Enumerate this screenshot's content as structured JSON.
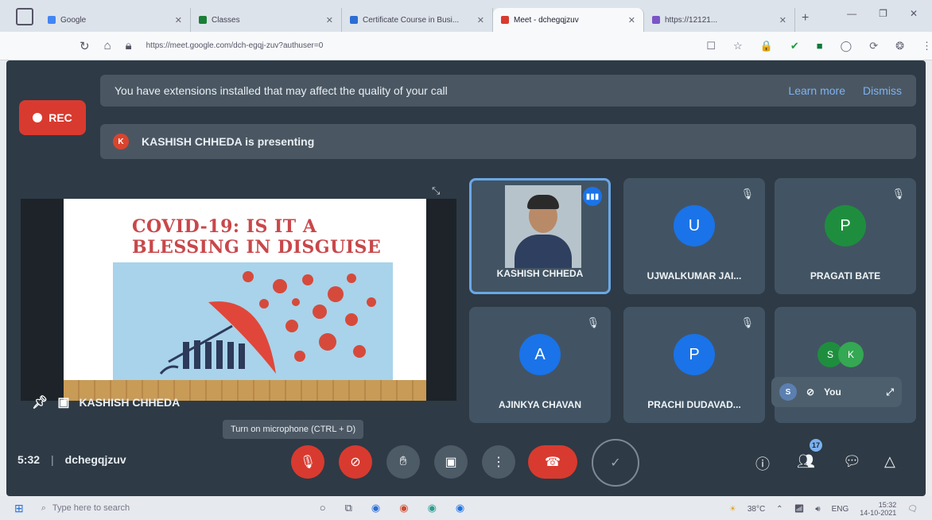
{
  "browser": {
    "tabs": [
      {
        "label": "Google",
        "color": "#4285f4",
        "active": false
      },
      {
        "label": "Classes",
        "color": "#1a7f37",
        "active": false
      },
      {
        "label": "Certificate Course in Busi...",
        "color": "#2c6dd4",
        "active": false
      },
      {
        "label": "Meet - dchegqjzuv",
        "color": "#d93a2f",
        "active": true
      },
      {
        "label": "https://12121...",
        "color": "#7a55c7",
        "active": false
      }
    ],
    "url": "https://meet.google.com/dch-egqj-zuv?authuser=0",
    "new_tab": "+",
    "window_controls": [
      "—",
      "❐",
      "✕"
    ],
    "extension_icons": [
      "☐",
      "☆",
      "🔒",
      "✔",
      "■",
      "◯",
      "⟳",
      "❂",
      "⋮"
    ]
  },
  "meet": {
    "rec_label": "REC",
    "extensions_banner": {
      "text": "You have extensions installed that may affect the quality of your call",
      "learn_more": "Learn more",
      "dismiss": "Dismiss"
    },
    "presenting": {
      "initial": "K",
      "text": "KASHISH CHHEDA is presenting"
    },
    "presentation": {
      "presenter_label": "KASHISH CHHEDA",
      "slide_title_1": "COVID-19: IS IT A",
      "slide_title_2": "BLESSING IN DISGUISE"
    },
    "participants": [
      {
        "name": "KASHISH CHHEDA",
        "initial": "",
        "color": "",
        "speaking": true
      },
      {
        "name": "UJWALKUMAR JAI...",
        "initial": "U",
        "color": "#1a73e8",
        "speaking": false
      },
      {
        "name": "PRAGATI BATE",
        "initial": "P",
        "color": "#1e8e3e",
        "speaking": false
      },
      {
        "name": "AJINKYA CHAVAN",
        "initial": "A",
        "color": "#1a73e8",
        "speaking": false
      },
      {
        "name": "PRACHI DUDAVAD...",
        "initial": "P",
        "color": "#1a73e8",
        "speaking": false
      }
    ],
    "extra_tile": {
      "initials": [
        "S",
        "K"
      ],
      "colors": [
        "#1e8e3e",
        "#34a853"
      ]
    },
    "self_view": {
      "initial": "S",
      "label": "You"
    },
    "tooltip": "Turn on microphone (CTRL + D)",
    "meeting_time": "5:32",
    "meeting_code": "dchegqjzuv",
    "people_count": "17"
  },
  "taskbar": {
    "search_placeholder": "Type here to search",
    "temperature": "38°C",
    "language": "ENG",
    "time": "15:32",
    "date": "14-10-2021"
  }
}
